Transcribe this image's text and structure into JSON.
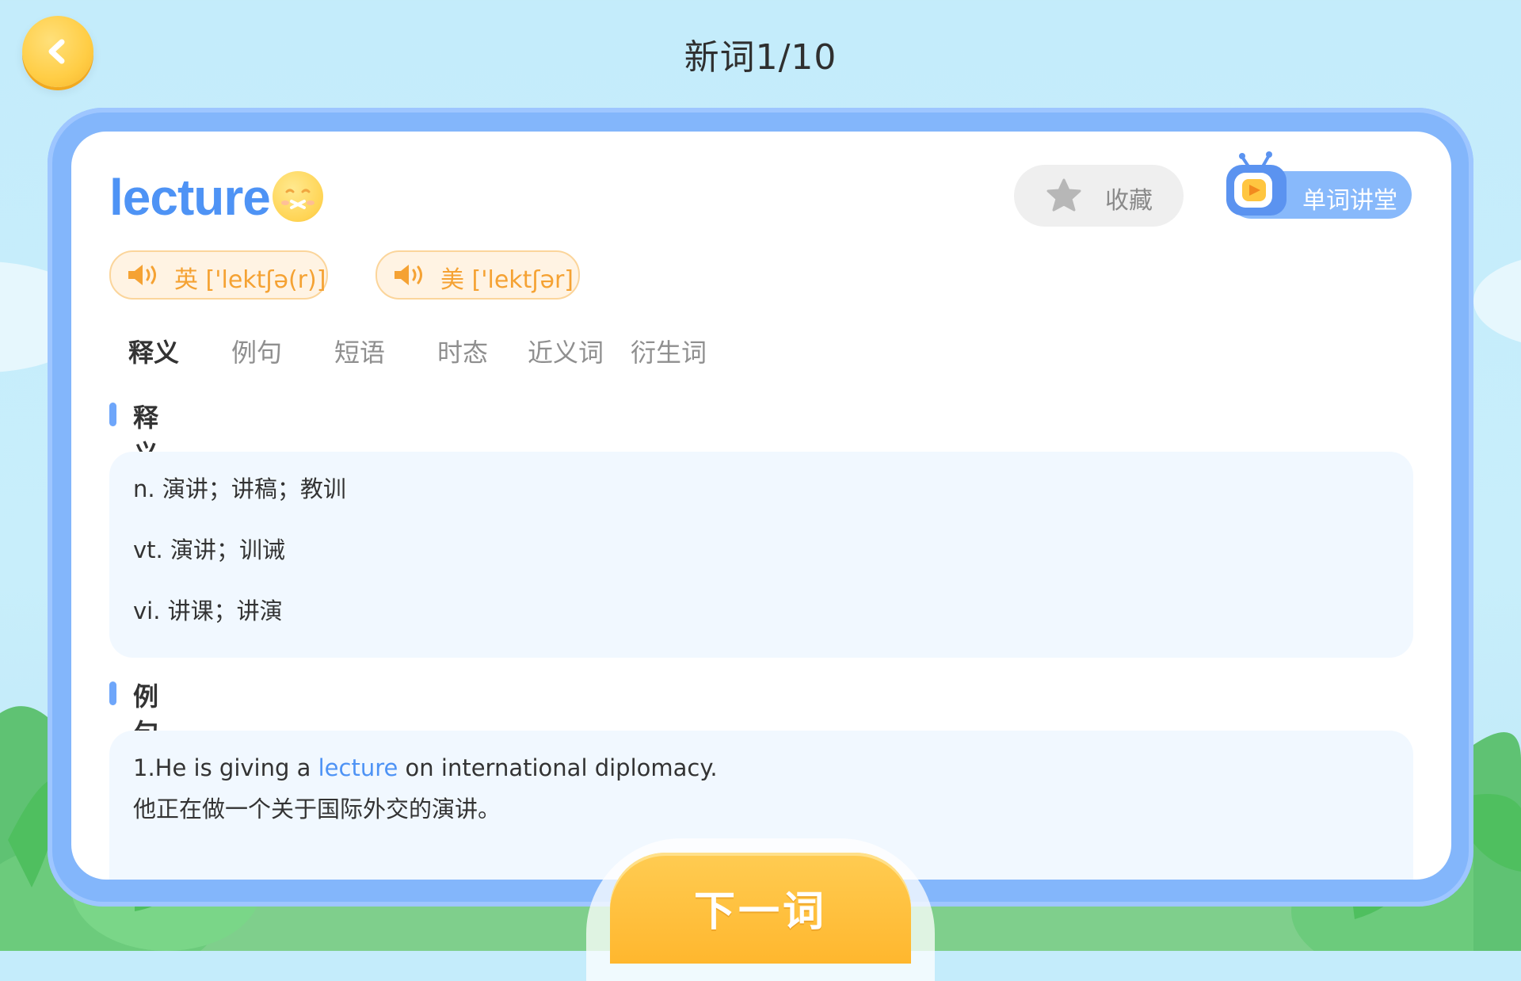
{
  "header": {
    "title": "新词1/10"
  },
  "word": {
    "text": "lecture",
    "favorite_label": "收藏",
    "lesson_label": "单词讲堂",
    "pronunciations": [
      {
        "label": "英 ['lektʃə(r)]"
      },
      {
        "label": "美 ['lektʃər]"
      }
    ]
  },
  "tabs": [
    {
      "label": "释义",
      "active": true
    },
    {
      "label": "例句",
      "active": false
    },
    {
      "label": "短语",
      "active": false
    },
    {
      "label": "时态",
      "active": false
    },
    {
      "label": "近义词",
      "active": false
    },
    {
      "label": "衍生词",
      "active": false
    }
  ],
  "definition_section": {
    "title": "释义",
    "lines": [
      "n. 演讲；讲稿；教训",
      "vt. 演讲；训诫",
      "vi. 讲课；讲演"
    ]
  },
  "example_section": {
    "title": "例句",
    "examples": [
      {
        "en_before": "1.He is giving a ",
        "en_highlight": "lecture",
        "en_after": " on international diplomacy.",
        "zh": "他正在做一个关于国际外交的演讲。"
      }
    ]
  },
  "footer": {
    "next_label": "下一词"
  },
  "colors": {
    "accent_blue": "#4e93f5",
    "accent_orange": "#f5a233",
    "button_yellow": "#ffb72e",
    "frame_blue": "#83b6fb"
  }
}
